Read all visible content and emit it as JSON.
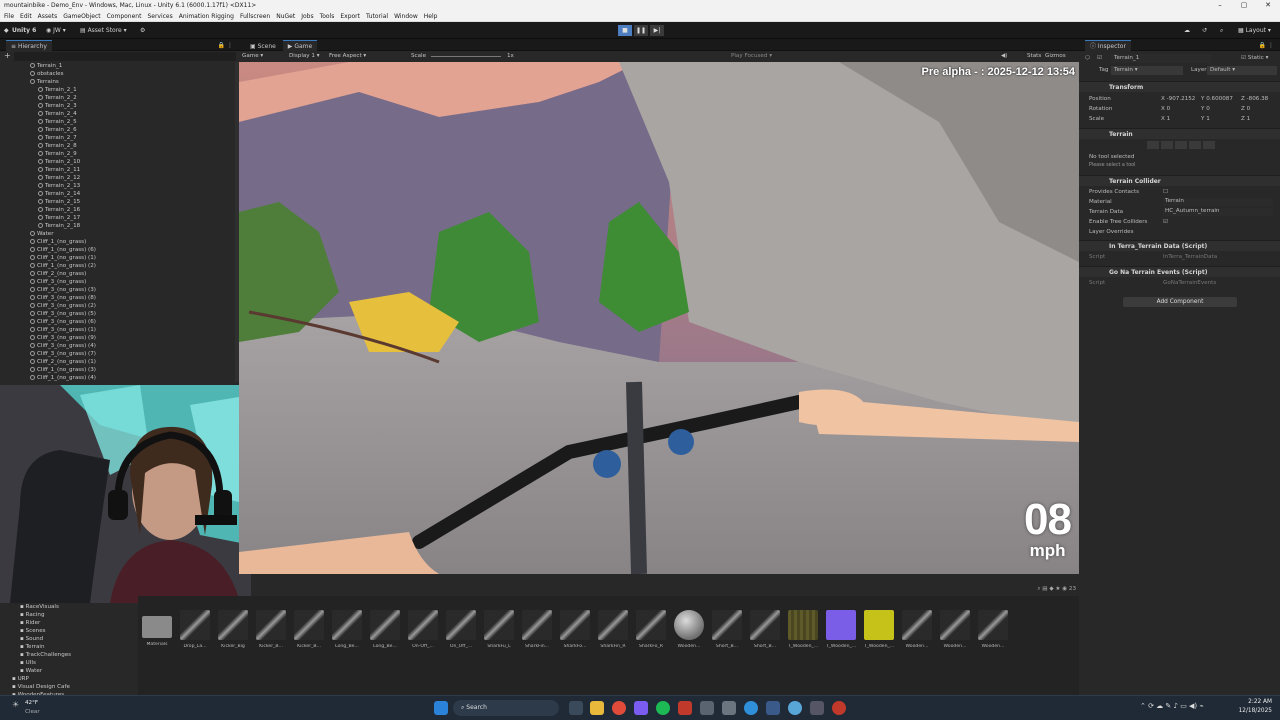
{
  "window": {
    "title": "mountainbike - Demo_Env - Windows, Mac, Linux - Unity 6.1 (6000.1.17f1) <DX11>",
    "controls": [
      "–",
      "▢",
      "✕"
    ]
  },
  "menu": [
    "File",
    "Edit",
    "Assets",
    "GameObject",
    "Component",
    "Services",
    "Animation Rigging",
    "Fullscreen",
    "NuGet",
    "Jobs",
    "Tools",
    "Export",
    "Tutorial",
    "Window",
    "Help"
  ],
  "toolbar": {
    "product": "Unity 6",
    "account": "JW",
    "asset_store": "Asset Store",
    "layout": "Layout"
  },
  "hierarchy": {
    "tab": "Hierarchy",
    "items": [
      {
        "label": "Terrain_1",
        "indent": 3
      },
      {
        "label": "obstacles",
        "indent": 3
      },
      {
        "label": "Terrains",
        "indent": 3
      },
      {
        "label": "Terrain_2_1",
        "indent": 4
      },
      {
        "label": "Terrain_2_2",
        "indent": 4
      },
      {
        "label": "Terrain_2_3",
        "indent": 4
      },
      {
        "label": "Terrain_2_4",
        "indent": 4
      },
      {
        "label": "Terrain_2_5",
        "indent": 4
      },
      {
        "label": "Terrain_2_6",
        "indent": 4
      },
      {
        "label": "Terrain_2_7",
        "indent": 4
      },
      {
        "label": "Terrain_2_8",
        "indent": 4
      },
      {
        "label": "Terrain_2_9",
        "indent": 4
      },
      {
        "label": "Terrain_2_10",
        "indent": 4
      },
      {
        "label": "Terrain_2_11",
        "indent": 4
      },
      {
        "label": "Terrain_2_12",
        "indent": 4
      },
      {
        "label": "Terrain_2_13",
        "indent": 4
      },
      {
        "label": "Terrain_2_14",
        "indent": 4
      },
      {
        "label": "Terrain_2_15",
        "indent": 4
      },
      {
        "label": "Terrain_2_16",
        "indent": 4
      },
      {
        "label": "Terrain_2_17",
        "indent": 4
      },
      {
        "label": "Terrain_2_18",
        "indent": 4
      },
      {
        "label": "Water",
        "indent": 3
      },
      {
        "label": "Cliff_1_(no_grass)",
        "indent": 3
      },
      {
        "label": "Cliff_1_(no_grass) (6)",
        "indent": 3
      },
      {
        "label": "Cliff_1_(no_grass) (1)",
        "indent": 3
      },
      {
        "label": "Cliff_1_(no_grass) (2)",
        "indent": 3
      },
      {
        "label": "Cliff_2_(no_grass)",
        "indent": 3
      },
      {
        "label": "Cliff_3_(no_grass)",
        "indent": 3
      },
      {
        "label": "Cliff_3_(no_grass) (3)",
        "indent": 3
      },
      {
        "label": "Cliff_3_(no_grass) (8)",
        "indent": 3
      },
      {
        "label": "Cliff_3_(no_grass) (2)",
        "indent": 3
      },
      {
        "label": "Cliff_3_(no_grass) (5)",
        "indent": 3
      },
      {
        "label": "Cliff_3_(no_grass) (6)",
        "indent": 3
      },
      {
        "label": "Cliff_3_(no_grass) (1)",
        "indent": 3
      },
      {
        "label": "Cliff_3_(no_grass) (9)",
        "indent": 3
      },
      {
        "label": "Cliff_3_(no_grass) (4)",
        "indent": 3
      },
      {
        "label": "Cliff_3_(no_grass) (7)",
        "indent": 3
      },
      {
        "label": "Cliff_2_(no_grass) (1)",
        "indent": 3
      },
      {
        "label": "Cliff_1_(no_grass) (3)",
        "indent": 3
      },
      {
        "label": "Cliff_1_(no_grass) (4)",
        "indent": 3
      }
    ]
  },
  "sceneview": {
    "tab_scene": "Scene",
    "tab_game": "Game",
    "game_dropdown": "Game",
    "display": "Display 1",
    "aspect": "Free Aspect",
    "scale_label": "Scale",
    "scale_value": "1x",
    "play_focused": "Play Focused",
    "stats": "Stats",
    "gizmos": "Gizmos"
  },
  "game": {
    "build_label": "Pre alpha - : 2025-12-12 13:54",
    "speed_value": "08",
    "speed_unit": "mph"
  },
  "project": {
    "tree": [
      "RaceVisuals",
      "Racing",
      "Rider",
      "Scenes",
      "Sound",
      "Terrain",
      "TrackChallenges",
      "UIIs",
      "Water",
      "URP",
      "Visual Design Cafe",
      "WoodenFeatures"
    ],
    "assets": [
      {
        "label": "Materials",
        "kind": "folder"
      },
      {
        "label": "Drop_La...",
        "kind": "mesh"
      },
      {
        "label": "Kicker_Big",
        "kind": "mesh"
      },
      {
        "label": "Kicker_B...",
        "kind": "mesh"
      },
      {
        "label": "Kicker_B...",
        "kind": "mesh"
      },
      {
        "label": "Long_Be...",
        "kind": "mesh"
      },
      {
        "label": "Long_Be...",
        "kind": "mesh"
      },
      {
        "label": "On-Off_...",
        "kind": "mesh"
      },
      {
        "label": "On_Off_...",
        "kind": "mesh"
      },
      {
        "label": "SharkFu_L",
        "kind": "mesh"
      },
      {
        "label": "SharkFin...",
        "kind": "mesh"
      },
      {
        "label": "SharkFo...",
        "kind": "mesh"
      },
      {
        "label": "SharkFin_R",
        "kind": "mesh"
      },
      {
        "label": "SharkFo_R",
        "kind": "mesh"
      },
      {
        "label": "Wooden...",
        "kind": "sphere"
      },
      {
        "label": "Short_B...",
        "kind": "mesh"
      },
      {
        "label": "Short_B...",
        "kind": "mesh"
      },
      {
        "label": "T_Wooden_...",
        "kind": "tex_olive"
      },
      {
        "label": "T_Wooden_...",
        "kind": "tex_purple"
      },
      {
        "label": "T_Wooden_...",
        "kind": "tex_yellow"
      },
      {
        "label": "Wooden...",
        "kind": "mesh"
      },
      {
        "label": "Wooden...",
        "kind": "mesh"
      },
      {
        "label": "Wooden...",
        "kind": "mesh"
      }
    ]
  },
  "inspector": {
    "tab": "Inspector",
    "object_name": "Terrain_1",
    "static_label": "Static",
    "tag_label": "Tag",
    "tag_value": "Terrain",
    "layer_label": "Layer",
    "layer_value": "Default",
    "transform": {
      "title": "Transform",
      "position_label": "Position",
      "rotation_label": "Rotation",
      "scale_label": "Scale",
      "pos": {
        "x": "-907.2152",
        "y": "0.600087",
        "z": "-806.38"
      },
      "rot": {
        "x": "0",
        "y": "0",
        "z": "0"
      },
      "scl": {
        "x": "1",
        "y": "1",
        "z": "1"
      }
    },
    "terrain": {
      "title": "Terrain",
      "no_tool": "No tool selected",
      "hint": "Please select a tool"
    },
    "collider": {
      "title": "Terrain Collider",
      "provides_contacts": "Provides Contacts",
      "material_label": "Material",
      "material_value": "Terrain",
      "data_label": "Terrain Data",
      "data_value": "HC_Autumn_terrain",
      "enable_trees": "Enable Tree Colliders",
      "layer_overrides": "Layer Overrides"
    },
    "script1": {
      "title": "In Terra_Terrain Data (Script)",
      "script_label": "Script",
      "script_value": "InTerra_TerrainData"
    },
    "script2": {
      "title": "Go Na Terrain Events (Script)",
      "script_label": "Script",
      "script_value": "GoNaTerrainEvents"
    },
    "add_component": "Add Component"
  },
  "taskbar": {
    "weather_temp": "42°F",
    "weather_desc": "Clear",
    "search": "Search",
    "time": "2:22 AM",
    "date": "12/18/2025"
  },
  "colors": {
    "accent": "#3a79bb",
    "editor_bg": "#282828",
    "dark_bg": "#191919"
  }
}
